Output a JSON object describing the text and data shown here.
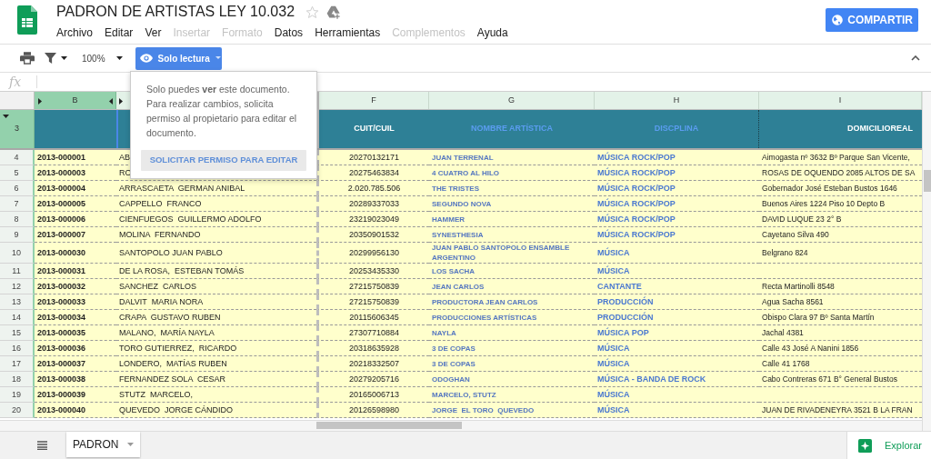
{
  "document": {
    "title": "PADRON DE ARTISTAS LEY 10.032",
    "starred": false
  },
  "menu": [
    {
      "label": "Archivo",
      "disabled": false
    },
    {
      "label": "Editar",
      "disabled": false
    },
    {
      "label": "Ver",
      "disabled": false
    },
    {
      "label": "Insertar",
      "disabled": true
    },
    {
      "label": "Formato",
      "disabled": true
    },
    {
      "label": "Datos",
      "disabled": false
    },
    {
      "label": "Herramientas",
      "disabled": false
    },
    {
      "label": "Complementos",
      "disabled": true
    },
    {
      "label": "Ayuda",
      "disabled": false
    }
  ],
  "share_button": "COMPARTIR",
  "toolbar": {
    "zoom": "100%",
    "mode_button": "Solo lectura"
  },
  "formula_bar": {
    "label": "fx"
  },
  "popup": {
    "message": "Solo puedes **ver** este documento. Para realizar cambios, solicita permiso al propietario para editar el documento.",
    "button": "SOLICITAR PERMISO PARA EDITAR"
  },
  "columns": [
    {
      "letter": "B",
      "selected": true
    },
    {
      "letter": "F",
      "selected": false
    },
    {
      "letter": "G",
      "selected": false
    },
    {
      "letter": "H",
      "selected": false
    },
    {
      "letter": "I",
      "selected": false
    }
  ],
  "header_row": {
    "number": "3",
    "cuit": "CUIT/CUIL",
    "artist": "NOMBRE ARTÍSTICA",
    "discipline": "DISCPLINA",
    "address": "DOMICILIOREAL"
  },
  "rows": [
    {
      "number": "4",
      "id": "2013-000001",
      "name": "AB",
      "cuit": "20270132171",
      "artist": "JUAN TERRENAL",
      "discipline": "MÚSICA ROCK/POP",
      "address": "Aimogasta nº 3632 Bº Parque San Vicente,"
    },
    {
      "number": "5",
      "id": "2013-000003",
      "name": "RO",
      "cuit": "20275463834",
      "artist": "4 CUATRO AL HILO",
      "discipline": "MÚSICA ROCK/POP",
      "address": "ROSAS DE OQUENDO 2085 ALTOS DE SA"
    },
    {
      "number": "6",
      "id": "2013-000004",
      "name": "ARRASCAETA  GERMAN ANIBAL",
      "cuit": "2.020.785.506",
      "artist": "THE TRISTES",
      "discipline": "MÚSICA ROCK/POP",
      "address": "Gobernador José Esteban Bustos 1646"
    },
    {
      "number": "7",
      "id": "2013-000005",
      "name": "CAPPELLO  FRANCO",
      "cuit": "20289337033",
      "artist": "SEGUNDO NOVA",
      "discipline": "MÚSICA ROCK/POP",
      "address": "Buenos Aires 1224 Piso 10 Depto B"
    },
    {
      "number": "8",
      "id": "2013-000006",
      "name": "CIENFUEGOS  GUILLERMO ADOLFO",
      "cuit": "23219023049",
      "artist": "HAMMER",
      "discipline": "MÚSICA ROCK/POP",
      "address": "DAVID LUQUE 23 2° B"
    },
    {
      "number": "9",
      "id": "2013-000007",
      "name": "MOLINA  FERNANDO",
      "cuit": "20350901532",
      "artist": "SYNESTHESIA",
      "discipline": "MÚSICA ROCK/POP",
      "address": "Cayetano Silva 490"
    },
    {
      "number": "10",
      "id": "2013-000030",
      "name": "SANTOPOLO JUAN PABLO",
      "cuit": "20299956130",
      "artist": "JUAN PABLO SANTOPOLO ENSAMBLE ARGENTINO",
      "discipline": "MÚSICA",
      "address": "Belgrano 824"
    },
    {
      "number": "11",
      "id": "2013-000031",
      "name": "DE LA ROSA,  ESTEBAN TOMÁS",
      "cuit": "20253435330",
      "artist": "LOS SACHA",
      "discipline": "MÚSICA"
    },
    {
      "number": "12",
      "id": "2013-000032",
      "name": "SANCHEZ  CARLOS",
      "cuit": "27215750839",
      "artist": "JEAN CARLOS",
      "discipline": "CANTANTE",
      "address": "Recta Martinolli 8548"
    },
    {
      "number": "13",
      "id": "2013-000033",
      "name": "DALVIT  MARIA NORA",
      "cuit": "27215750839",
      "artist": "PRODUCTORA JEAN CARLOS",
      "discipline": "PRODUCCIÓN",
      "address": "Agua Sacha 8561"
    },
    {
      "number": "14",
      "id": "2013-000034",
      "name": "CRAPA  GUSTAVO RUBEN",
      "cuit": "20115606345",
      "artist": "PRODUCCIONES ARTÍSTICAS",
      "discipline": "PRODUCCIÓN",
      "address": "Obispo Clara 97 Bº Santa Martín"
    },
    {
      "number": "15",
      "id": "2013-000035",
      "name": "MALANO,  MARÍA NAYLA",
      "cuit": "27307710884",
      "artist": "NAYLA",
      "discipline": "MÚSICA POP",
      "address": "Jachal 4381"
    },
    {
      "number": "16",
      "id": "2013-000036",
      "name": "TORO GUTIERREZ,  RICARDO",
      "cuit": "20318635928",
      "artist": "3 DE COPAS",
      "discipline": "MÚSICA",
      "address": "Calle 43 José A Nanini 1856"
    },
    {
      "number": "17",
      "id": "2013-000037",
      "name": "LONDERO,  MATÍAS RUBEN",
      "cuit": "20218332507",
      "artist": "3 DE COPAS",
      "discipline": "MÚSICA",
      "address": "Calle 41 1768"
    },
    {
      "number": "18",
      "id": "2013-000038",
      "name": "FERNANDEZ SOLA  CESAR",
      "cuit": "20279205716",
      "artist": "ODOGHAN",
      "discipline": "MÚSICA - BANDA DE ROCK",
      "address": "Cabo Contreras 671 B° General Bustos"
    },
    {
      "number": "19",
      "id": "2013-000039",
      "name": "STUTZ  MARCELO,",
      "cuit": "20165006713",
      "artist": "MARCELO, STUTZ",
      "discipline": "MÚSICA"
    },
    {
      "number": "20",
      "id": "2013-000040",
      "name": "QUEVEDO  JORGE CÁNDIDO",
      "cuit": "20126598980",
      "artist": "JORGE  EL TORO  QUEVEDO",
      "discipline": "MÚSICA",
      "address": "JUAN DE RIVADENEYRA 3521 B LA FRAN"
    }
  ],
  "sheet_tabs": [
    {
      "label": "PADRON",
      "selected": true
    }
  ],
  "explore_button": "Explorar"
}
